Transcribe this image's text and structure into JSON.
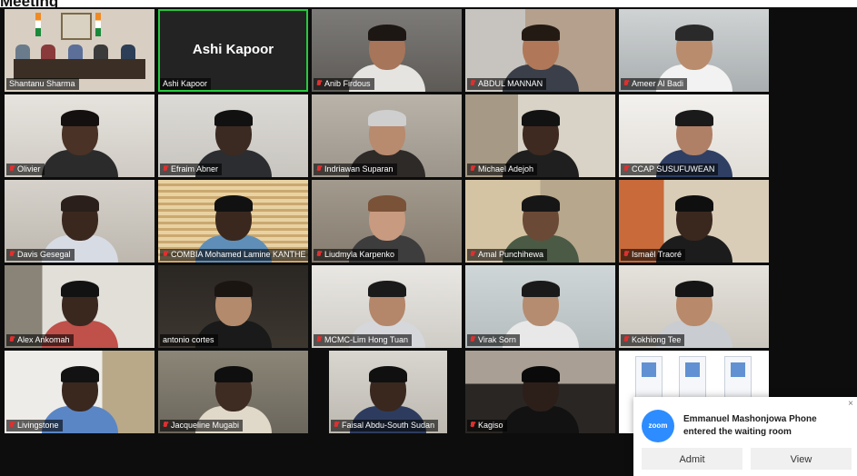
{
  "window": {
    "top_caption": "Meeting"
  },
  "active_speaker": "Ashi Kapoor",
  "participants": [
    {
      "name": "Shantanu Sharma",
      "muted": false
    },
    {
      "name": "Ashi Kapoor",
      "muted": false,
      "video_off": true
    },
    {
      "name": "Anib Firdous",
      "muted": true
    },
    {
      "name": "ABDUL MANNAN",
      "muted": true
    },
    {
      "name": "Ameer Al Badi",
      "muted": true
    },
    {
      "name": "Olivier",
      "muted": true
    },
    {
      "name": "Efraim Abner",
      "muted": true
    },
    {
      "name": "Indriawan Suparan",
      "muted": true
    },
    {
      "name": "Michael Adejoh",
      "muted": true
    },
    {
      "name": "CCAP SUSUFUWEAN",
      "muted": true
    },
    {
      "name": "Davis Gesegal",
      "muted": true
    },
    {
      "name": "COMBIA Mohamed Lamine KANTHE",
      "muted": true
    },
    {
      "name": "Liudmyla Karpenko",
      "muted": true
    },
    {
      "name": "Amal Punchihewa",
      "muted": true
    },
    {
      "name": "Ismaël Traoré",
      "muted": true
    },
    {
      "name": "Alex Ankomah",
      "muted": true
    },
    {
      "name": "antonio cortes",
      "muted": false
    },
    {
      "name": "MCMC-Lim Hong Tuan",
      "muted": true
    },
    {
      "name": "Virak Sorn",
      "muted": true
    },
    {
      "name": "Kokhiong Tee",
      "muted": true
    },
    {
      "name": "Livingstone",
      "muted": true
    },
    {
      "name": "Jacqueline Mugabi",
      "muted": true
    },
    {
      "name": "Faisal Abdu-South Sudan",
      "muted": true
    },
    {
      "name": "Kagiso",
      "muted": true
    },
    {
      "name": "",
      "muted": false
    }
  ],
  "notification": {
    "logo_text": "zoom",
    "message": "Emmanuel Mashonjowa Phone entered the waiting room",
    "admit_label": "Admit",
    "view_label": "View",
    "close_glyph": "×"
  },
  "colors": {
    "active_border": "#27c93f",
    "muted_icon": "#e02f2f",
    "zoom_blue": "#2d8cff"
  }
}
